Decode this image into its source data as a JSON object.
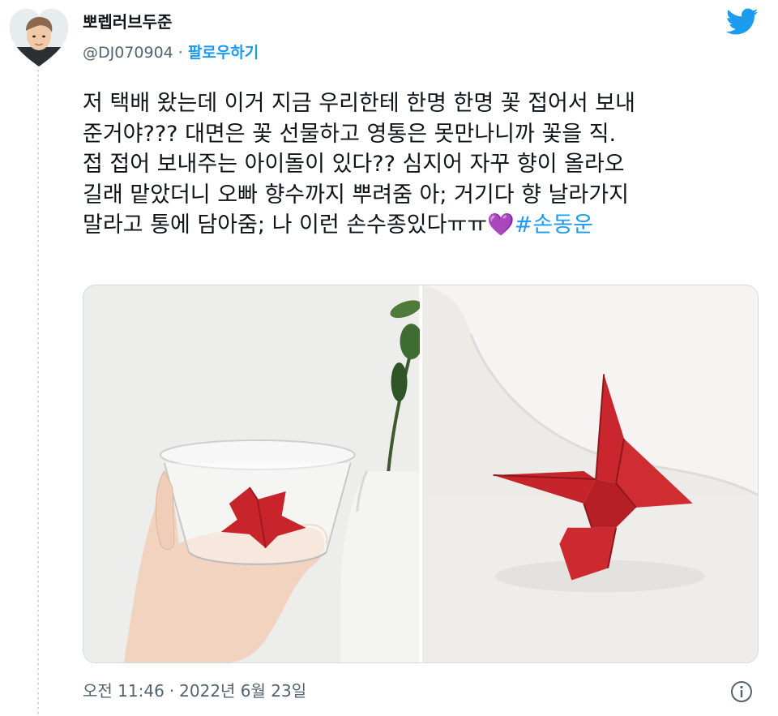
{
  "author": {
    "display_name": "뽀렙러브두준",
    "handle": "@DJ070904",
    "separator": "·",
    "follow_label": "팔로우하기"
  },
  "tweet": {
    "text": "저 택배 왔는데 이거 지금 우리한테 한명 한명 꽃 접어서 보내\n준거야??? 대면은 꽃 선물하고 영통은 못만나니까 꽃을 직.\n접 접어 보내주는 아이돌이 있다?? 심지어 자꾸 향이 올라오\n길래 맡았더니 오빠 향수까지 뿌려줌 아; 거기다 향 날라가지\n말라고 통에 담아줌; 나 이런 손수종있다ㅠㅠ",
    "emoji": "💜",
    "hashtag": "#손동운"
  },
  "media": [
    {
      "icon": "photo-cup-origami"
    },
    {
      "icon": "photo-origami-flower"
    }
  ],
  "timestamp": {
    "time": "오전 11:46",
    "separator": "·",
    "date": "2022년 6월 23일"
  },
  "icons": {
    "brand": "twitter-bird-icon",
    "info": "info-icon"
  },
  "colors": {
    "accent": "#1d9bf0",
    "text": "#0f1419",
    "secondary": "#536471",
    "border": "#cfd9de"
  }
}
